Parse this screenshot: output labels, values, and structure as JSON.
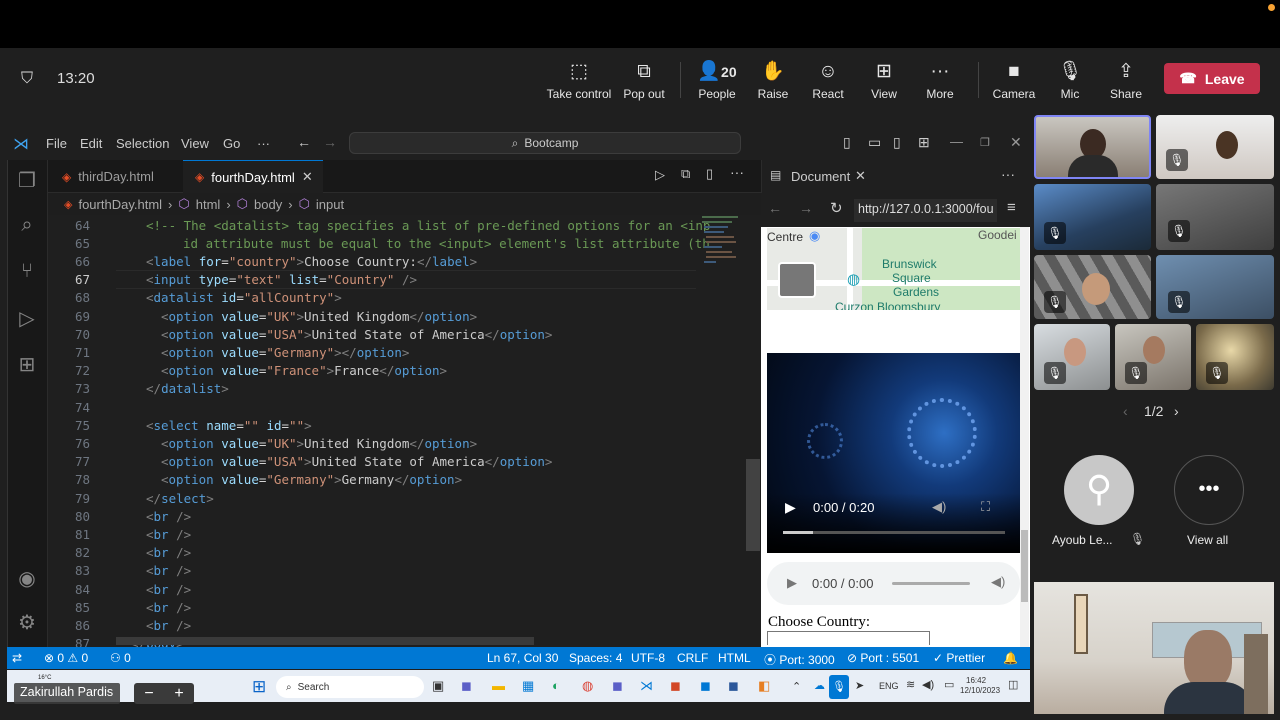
{
  "meeting": {
    "time": "13:20",
    "buttons": [
      {
        "label": "Take control",
        "icon": "take-control-icon"
      },
      {
        "label": "Pop out",
        "icon": "pop-out-icon"
      },
      {
        "label": "People",
        "icon": "people-icon",
        "count": "20"
      },
      {
        "label": "Raise",
        "icon": "raise-hand-icon"
      },
      {
        "label": "React",
        "icon": "react-icon"
      },
      {
        "label": "View",
        "icon": "view-icon"
      },
      {
        "label": "More",
        "icon": "more-icon"
      },
      {
        "label": "Camera",
        "icon": "camera-icon"
      },
      {
        "label": "Mic",
        "icon": "mic-off-icon"
      },
      {
        "label": "Share",
        "icon": "share-icon"
      }
    ],
    "leave_label": "Leave",
    "pager": "1/2",
    "participant_name": "Ayoub Le...",
    "view_all": "View all",
    "presenter_name": "Zakirullah Pardis",
    "colors": {
      "leave": "#c4314b",
      "active_border": "#7f85f5"
    }
  },
  "vscode": {
    "menu": [
      "File",
      "Edit",
      "Selection",
      "View",
      "Go",
      "···"
    ],
    "search": "Bootcamp",
    "tabs": [
      {
        "label": "thirdDay.html",
        "active": false
      },
      {
        "label": "fourthDay.html",
        "active": true
      }
    ],
    "breadcrumb": [
      "fourthDay.html",
      "html",
      "body",
      "input"
    ],
    "preview_tab": "Document",
    "url": "http://127.0.0.1:3000/fou",
    "map_labels": [
      "Centre",
      "Brunswick",
      "Square",
      "Gardens",
      "Curzon Bloomsbury",
      "Goodei"
    ],
    "video_time": "0:00 / 0:20",
    "audio_time": "0:00 / 0:00",
    "choose_country": "Choose Country:",
    "line_numbers": [
      "64",
      "65",
      "66",
      "67",
      "68",
      "69",
      "70",
      "71",
      "72",
      "73",
      "74",
      "75",
      "76",
      "77",
      "78",
      "79",
      "80",
      "81",
      "82",
      "83",
      "84",
      "85",
      "86",
      "87"
    ],
    "status": {
      "errors": "0",
      "warnings": "0",
      "ports": "0",
      "position": "Ln 67, Col 30",
      "spaces": "Spaces: 4",
      "encoding": "UTF-8",
      "eol": "CRLF",
      "language": "HTML",
      "port1": "Port: 3000",
      "port2": "Port : 5501",
      "prettier": "Prettier"
    },
    "colors": {
      "statusbar": "#0078d4",
      "editor_bg": "#1f1f1f",
      "tag": "#569cd6",
      "attr": "#9cdcfe",
      "string": "#ce9178",
      "comment": "#6a9955"
    }
  },
  "taskbar": {
    "search": "Search",
    "weather_temp": "16°C",
    "lang": "ENG",
    "time": "16:42",
    "date": "12/10/2023"
  }
}
